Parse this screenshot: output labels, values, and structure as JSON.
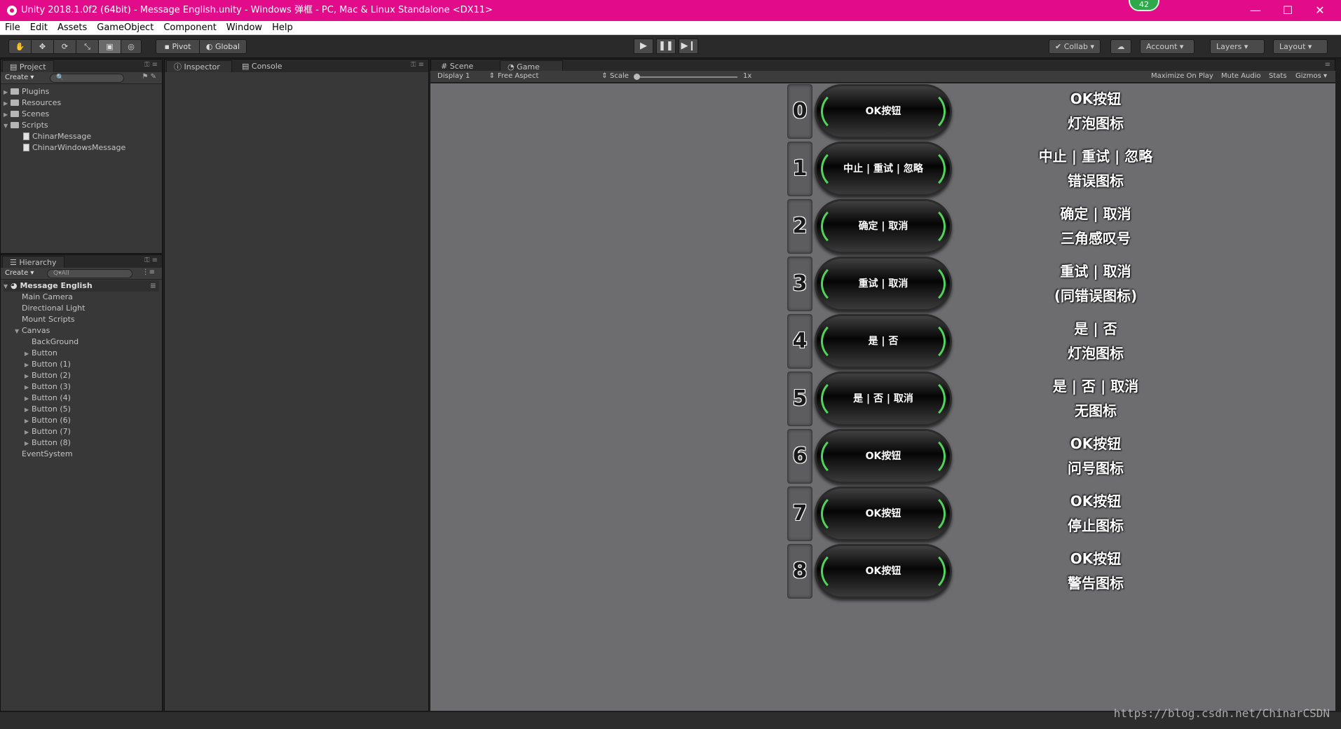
{
  "window": {
    "title": "Unity 2018.1.0f2 (64bit) - Message English.unity - Windows 弹框 - PC, Mac & Linux Standalone <DX11>",
    "badge": "42",
    "controls": {
      "minimize": "—",
      "maximize": "☐",
      "close": "✕"
    }
  },
  "menu": [
    "File",
    "Edit",
    "Assets",
    "GameObject",
    "Component",
    "Window",
    "Help"
  ],
  "toolbar": {
    "pivot": "Pivot",
    "global": "Global",
    "collab": "Collab",
    "account": "Account",
    "layers": "Layers",
    "layout": "Layout"
  },
  "project": {
    "tab": "Project",
    "create": "Create",
    "items": [
      {
        "label": "Plugins",
        "type": "folder"
      },
      {
        "label": "Resources",
        "type": "folder"
      },
      {
        "label": "Scenes",
        "type": "folder"
      },
      {
        "label": "Scripts",
        "type": "folder"
      },
      {
        "label": "ChinarMessage",
        "type": "file"
      },
      {
        "label": "ChinarWindowsMessage",
        "type": "file"
      }
    ]
  },
  "hierarchy": {
    "tab": "Hierarchy",
    "create": "Create",
    "search": "All",
    "scene": "Message English",
    "items": [
      "Main Camera",
      "Directional Light",
      "Mount Scripts",
      "Canvas",
      "BackGround",
      "Button",
      "Button (1)",
      "Button (2)",
      "Button (3)",
      "Button (4)",
      "Button (5)",
      "Button (6)",
      "Button (7)",
      "Button (8)",
      "EventSystem"
    ]
  },
  "inspector": {
    "tab": "Inspector",
    "console": "Console"
  },
  "game": {
    "scene_tab": "Scene",
    "game_tab": "Game",
    "display": "Display 1",
    "aspect": "Free Aspect",
    "scale_label": "Scale",
    "scale_value": "1x",
    "maximize": "Maximize On Play",
    "mute": "Mute Audio",
    "stats": "Stats",
    "gizmos": "Gizmos",
    "buttons": [
      {
        "num": "0",
        "label": "OK按钮",
        "line1": "OK按钮",
        "line2": "灯泡图标"
      },
      {
        "num": "1",
        "label": "中止 | 重试 | 忽略",
        "line1": "中止 | 重试 | 忽略",
        "line2": "错误图标"
      },
      {
        "num": "2",
        "label": "确定 | 取消",
        "line1": "确定 | 取消",
        "line2": "三角感叹号"
      },
      {
        "num": "3",
        "label": "重试 | 取消",
        "line1": "重试 | 取消",
        "line2": "(同错误图标)"
      },
      {
        "num": "4",
        "label": "是 | 否",
        "line1": "是 | 否",
        "line2": "灯泡图标"
      },
      {
        "num": "5",
        "label": "是 | 否 | 取消",
        "line1": "是 | 否 | 取消",
        "line2": "无图标"
      },
      {
        "num": "6",
        "label": "OK按钮",
        "line1": "OK按钮",
        "line2": "问号图标"
      },
      {
        "num": "7",
        "label": "OK按钮",
        "line1": "OK按钮",
        "line2": "停止图标"
      },
      {
        "num": "8",
        "label": "OK按钮",
        "line1": "OK按钮",
        "line2": "警告图标"
      }
    ]
  },
  "watermark": "https://blog.csdn.net/ChinarCSDN"
}
